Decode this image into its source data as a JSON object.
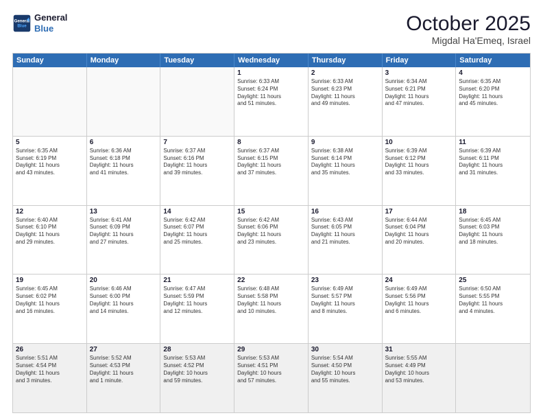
{
  "logo": {
    "line1": "General",
    "line2": "Blue"
  },
  "title": "October 2025",
  "subtitle": "Migdal Ha'Emeq, Israel",
  "header_days": [
    "Sunday",
    "Monday",
    "Tuesday",
    "Wednesday",
    "Thursday",
    "Friday",
    "Saturday"
  ],
  "weeks": [
    [
      {
        "day": "",
        "text": ""
      },
      {
        "day": "",
        "text": ""
      },
      {
        "day": "",
        "text": ""
      },
      {
        "day": "1",
        "text": "Sunrise: 6:33 AM\nSunset: 6:24 PM\nDaylight: 11 hours\nand 51 minutes."
      },
      {
        "day": "2",
        "text": "Sunrise: 6:33 AM\nSunset: 6:23 PM\nDaylight: 11 hours\nand 49 minutes."
      },
      {
        "day": "3",
        "text": "Sunrise: 6:34 AM\nSunset: 6:21 PM\nDaylight: 11 hours\nand 47 minutes."
      },
      {
        "day": "4",
        "text": "Sunrise: 6:35 AM\nSunset: 6:20 PM\nDaylight: 11 hours\nand 45 minutes."
      }
    ],
    [
      {
        "day": "5",
        "text": "Sunrise: 6:35 AM\nSunset: 6:19 PM\nDaylight: 11 hours\nand 43 minutes."
      },
      {
        "day": "6",
        "text": "Sunrise: 6:36 AM\nSunset: 6:18 PM\nDaylight: 11 hours\nand 41 minutes."
      },
      {
        "day": "7",
        "text": "Sunrise: 6:37 AM\nSunset: 6:16 PM\nDaylight: 11 hours\nand 39 minutes."
      },
      {
        "day": "8",
        "text": "Sunrise: 6:37 AM\nSunset: 6:15 PM\nDaylight: 11 hours\nand 37 minutes."
      },
      {
        "day": "9",
        "text": "Sunrise: 6:38 AM\nSunset: 6:14 PM\nDaylight: 11 hours\nand 35 minutes."
      },
      {
        "day": "10",
        "text": "Sunrise: 6:39 AM\nSunset: 6:12 PM\nDaylight: 11 hours\nand 33 minutes."
      },
      {
        "day": "11",
        "text": "Sunrise: 6:39 AM\nSunset: 6:11 PM\nDaylight: 11 hours\nand 31 minutes."
      }
    ],
    [
      {
        "day": "12",
        "text": "Sunrise: 6:40 AM\nSunset: 6:10 PM\nDaylight: 11 hours\nand 29 minutes."
      },
      {
        "day": "13",
        "text": "Sunrise: 6:41 AM\nSunset: 6:09 PM\nDaylight: 11 hours\nand 27 minutes."
      },
      {
        "day": "14",
        "text": "Sunrise: 6:42 AM\nSunset: 6:07 PM\nDaylight: 11 hours\nand 25 minutes."
      },
      {
        "day": "15",
        "text": "Sunrise: 6:42 AM\nSunset: 6:06 PM\nDaylight: 11 hours\nand 23 minutes."
      },
      {
        "day": "16",
        "text": "Sunrise: 6:43 AM\nSunset: 6:05 PM\nDaylight: 11 hours\nand 21 minutes."
      },
      {
        "day": "17",
        "text": "Sunrise: 6:44 AM\nSunset: 6:04 PM\nDaylight: 11 hours\nand 20 minutes."
      },
      {
        "day": "18",
        "text": "Sunrise: 6:45 AM\nSunset: 6:03 PM\nDaylight: 11 hours\nand 18 minutes."
      }
    ],
    [
      {
        "day": "19",
        "text": "Sunrise: 6:45 AM\nSunset: 6:02 PM\nDaylight: 11 hours\nand 16 minutes."
      },
      {
        "day": "20",
        "text": "Sunrise: 6:46 AM\nSunset: 6:00 PM\nDaylight: 11 hours\nand 14 minutes."
      },
      {
        "day": "21",
        "text": "Sunrise: 6:47 AM\nSunset: 5:59 PM\nDaylight: 11 hours\nand 12 minutes."
      },
      {
        "day": "22",
        "text": "Sunrise: 6:48 AM\nSunset: 5:58 PM\nDaylight: 11 hours\nand 10 minutes."
      },
      {
        "day": "23",
        "text": "Sunrise: 6:49 AM\nSunset: 5:57 PM\nDaylight: 11 hours\nand 8 minutes."
      },
      {
        "day": "24",
        "text": "Sunrise: 6:49 AM\nSunset: 5:56 PM\nDaylight: 11 hours\nand 6 minutes."
      },
      {
        "day": "25",
        "text": "Sunrise: 6:50 AM\nSunset: 5:55 PM\nDaylight: 11 hours\nand 4 minutes."
      }
    ],
    [
      {
        "day": "26",
        "text": "Sunrise: 5:51 AM\nSunset: 4:54 PM\nDaylight: 11 hours\nand 3 minutes."
      },
      {
        "day": "27",
        "text": "Sunrise: 5:52 AM\nSunset: 4:53 PM\nDaylight: 11 hours\nand 1 minute."
      },
      {
        "day": "28",
        "text": "Sunrise: 5:53 AM\nSunset: 4:52 PM\nDaylight: 10 hours\nand 59 minutes."
      },
      {
        "day": "29",
        "text": "Sunrise: 5:53 AM\nSunset: 4:51 PM\nDaylight: 10 hours\nand 57 minutes."
      },
      {
        "day": "30",
        "text": "Sunrise: 5:54 AM\nSunset: 4:50 PM\nDaylight: 10 hours\nand 55 minutes."
      },
      {
        "day": "31",
        "text": "Sunrise: 5:55 AM\nSunset: 4:49 PM\nDaylight: 10 hours\nand 53 minutes."
      },
      {
        "day": "",
        "text": ""
      }
    ]
  ]
}
